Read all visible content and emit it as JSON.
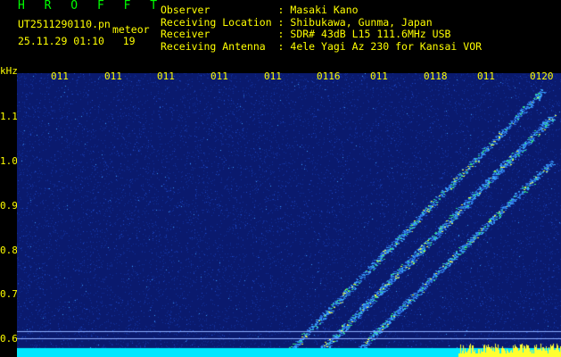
{
  "brand": "H R O F F T",
  "file": {
    "name": "UT2511290110.pn",
    "tag": "meteor",
    "datetime": "25.11.29 01:10",
    "count": "19"
  },
  "info": {
    "observer": {
      "label": "Observer",
      "value": "Masaki Kano"
    },
    "location": {
      "label": "Receiving Location",
      "value": "Shibukawa, Gunma, Japan"
    },
    "receiver": {
      "label": "Receiver",
      "value": "SDR# 43dB L15 111.6MHz USB"
    },
    "antenna": {
      "label": "Receiving Antenna",
      "value": "4ele Yagi Az 230 for Kansai VOR"
    }
  },
  "axis": {
    "unit": "kHz",
    "y_ticks": [
      "1.1",
      "1.0",
      "0.9",
      "0.8",
      "0.7",
      "0.6"
    ],
    "x_ticks": [
      "011",
      "011",
      "011",
      "011",
      "011",
      "0116",
      "011",
      "0118",
      "011",
      "0120"
    ]
  },
  "colors": {
    "text": "#ffff00",
    "brand": "#00ff00",
    "background": "#000000",
    "spectrum": "#0a1a6e"
  }
}
